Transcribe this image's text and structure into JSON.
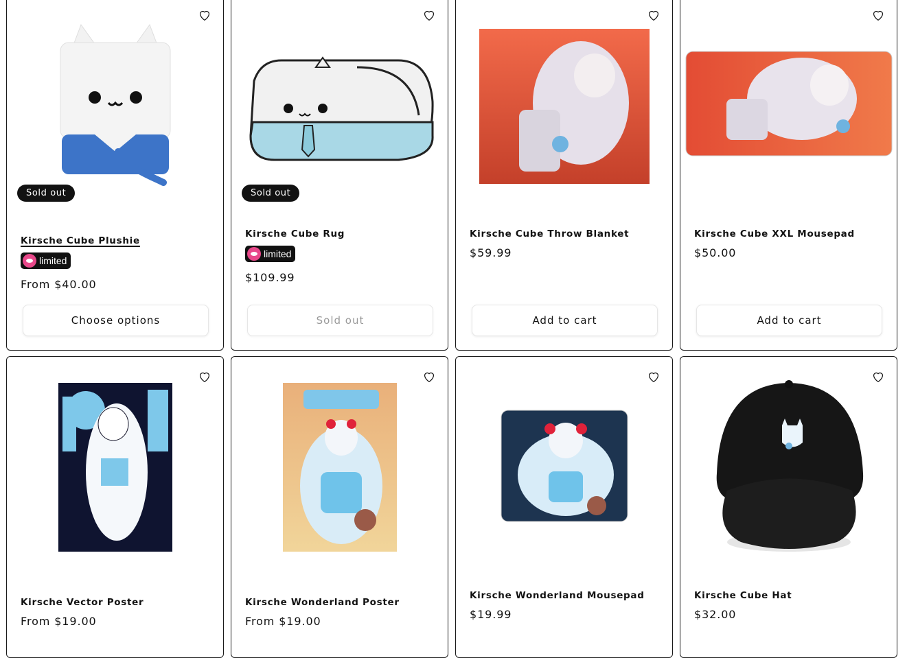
{
  "icons": {
    "wishlist": "heart-outline-icon"
  },
  "colors": {
    "sold_out_badge": "#121212",
    "limited_logo": "#e8488a",
    "button_border": "#e6e6e6"
  },
  "products": [
    {
      "title": "Kirsche Cube Plushie",
      "badge": "Sold out",
      "limited": "limited",
      "price": "From $40.00",
      "button": "Choose options"
    },
    {
      "title": "Kirsche Cube Rug",
      "badge": "Sold out",
      "limited": "limited",
      "price": "$109.99",
      "button": "Sold out"
    },
    {
      "title": "Kirsche Cube Throw Blanket",
      "price": "$59.99",
      "button": "Add to cart"
    },
    {
      "title": "Kirsche Cube XXL Mousepad",
      "price": "$50.00",
      "button": "Add to cart"
    },
    {
      "title": "Kirsche Vector Poster",
      "price": "From $19.00"
    },
    {
      "title": "Kirsche Wonderland Poster",
      "price": "From $19.00"
    },
    {
      "title": "Kirsche Wonderland Mousepad",
      "price": "$19.99"
    },
    {
      "title": "Kirsche Cube Hat",
      "price": "$32.00"
    }
  ]
}
